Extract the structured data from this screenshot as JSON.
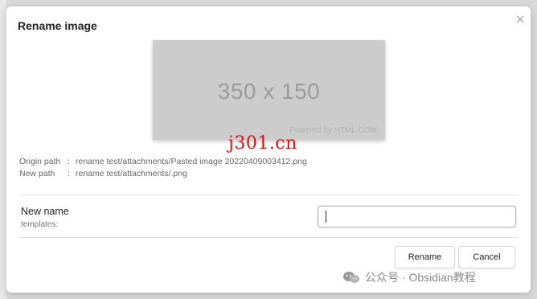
{
  "modal": {
    "title": "Rename image",
    "close_icon": "close-icon",
    "preview": {
      "dimensions_text": "350 x 150",
      "credit_text": "Powered by HTML.COM"
    },
    "watermark_site": "j301.cn",
    "origin_path": {
      "label": "Origin path",
      "separator": ":",
      "value": "rename test/attachments/Pasted image 20220409003412.png"
    },
    "new_path": {
      "label": "New path",
      "separator": ":",
      "value": "rename test/attachments/.png"
    },
    "setting": {
      "name": "New name",
      "description": "templates:",
      "input_value": "",
      "input_placeholder": ""
    },
    "buttons": {
      "rename": "Rename",
      "cancel": "Cancel"
    }
  },
  "watermark": {
    "icon": "wechat-icon",
    "text": "公众号 · Obsidian教程"
  }
}
